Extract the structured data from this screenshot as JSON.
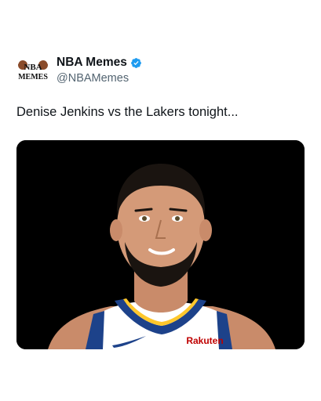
{
  "tweet": {
    "author": {
      "display_name": "NBA Memes",
      "handle": "@NBAMemes",
      "verified": true,
      "avatar": {
        "icon": "nba-memes-logo-icon",
        "logo_text_top": "NBA",
        "logo_text_bottom": "MEMES"
      }
    },
    "text": "Denise Jenkins vs the Lakers tonight...",
    "media": {
      "jersey_sponsor": "Rakuten",
      "background_color": "#000000"
    }
  },
  "colors": {
    "verified_badge": "#1d9bf0",
    "handle_text": "#536471",
    "jersey_blue": "#1d428a",
    "jersey_gold": "#ffc72c",
    "sponsor_red": "#bf0000"
  }
}
